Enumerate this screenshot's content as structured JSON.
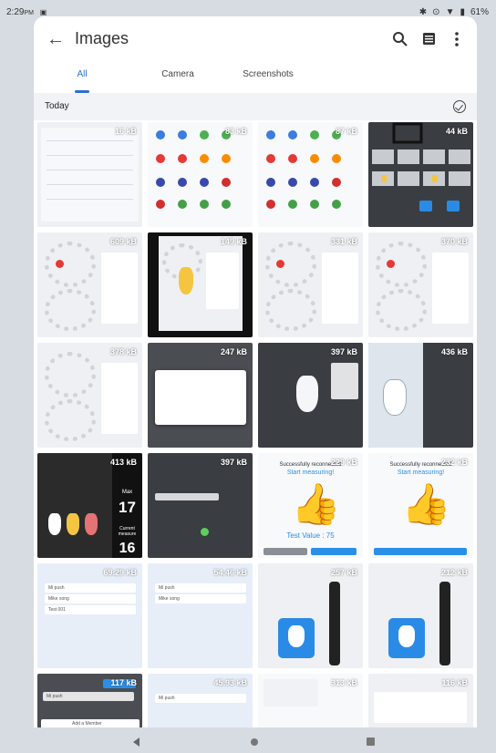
{
  "status": {
    "time": "2:29",
    "ampm": "PM",
    "battery": "61%"
  },
  "header": {
    "title": "Images"
  },
  "tabs": [
    {
      "label": "All",
      "active": true
    },
    {
      "label": "Camera",
      "active": false
    },
    {
      "label": "Screenshots",
      "active": false
    }
  ],
  "section": {
    "title": "Today"
  },
  "thumbnails": {
    "t1": {
      "size": "16 kB",
      "kind": "settings-screen"
    },
    "t2": {
      "size": "83 kB",
      "kind": "app-grid"
    },
    "t3": {
      "size": "87 kB",
      "kind": "app-grid"
    },
    "t4": {
      "size": "44 kB",
      "kind": "icon-grid"
    },
    "t5": {
      "size": "609 kB",
      "kind": "dental-chart"
    },
    "t6": {
      "size": "149 kB",
      "kind": "dental-chart-dark"
    },
    "t7": {
      "size": "331 kB",
      "kind": "dental-chart"
    },
    "t8": {
      "size": "370 kB",
      "kind": "dental-chart"
    },
    "t9": {
      "size": "378 kB",
      "kind": "dental-chart"
    },
    "t10": {
      "size": "247 kB",
      "kind": "dialog"
    },
    "t11": {
      "size": "397 kB",
      "kind": "overview"
    },
    "t12": {
      "size": "436 kB",
      "kind": "tooth-view"
    },
    "t13": {
      "size": "413 kB",
      "kind": "measure-result",
      "max_label": "Max",
      "max_value": "17",
      "current_label": "Current measure",
      "current_value": "16"
    },
    "t14": {
      "size": "397 kB",
      "kind": "patient-info"
    },
    "t15": {
      "size": "229 kB",
      "kind": "success",
      "headline": "Successfully reconnected",
      "subline": "Start measuring!",
      "result": "Test Value : 75"
    },
    "t16": {
      "size": "232 kB",
      "kind": "success",
      "headline": "Successfully reconnected",
      "subline": "Start measuring!"
    },
    "t17": {
      "size": "69.29 kB",
      "kind": "list",
      "item1": "Mi push",
      "item2": "Mike song",
      "item3": "Test 001"
    },
    "t18": {
      "size": "54.46 kB",
      "kind": "list",
      "item1": "Mi push",
      "item2": "Mike song"
    },
    "t19": {
      "size": "257 kB",
      "kind": "device"
    },
    "t20": {
      "size": "212 kB",
      "kind": "device"
    },
    "t21": {
      "size": "117 kB",
      "kind": "list-dark",
      "item1": "Mi push",
      "footer": "Add a Member"
    },
    "t22": {
      "size": "45.93 kB",
      "kind": "list",
      "item1": "Mi push"
    },
    "t23": {
      "size": "313 kB",
      "kind": "instruction"
    },
    "t24": {
      "size": "116 kB",
      "kind": "menu"
    }
  },
  "colors": {
    "accent": "#2f6fd0",
    "app_blue": "#2a8be6",
    "tooth_yellow": "#f5c542"
  }
}
